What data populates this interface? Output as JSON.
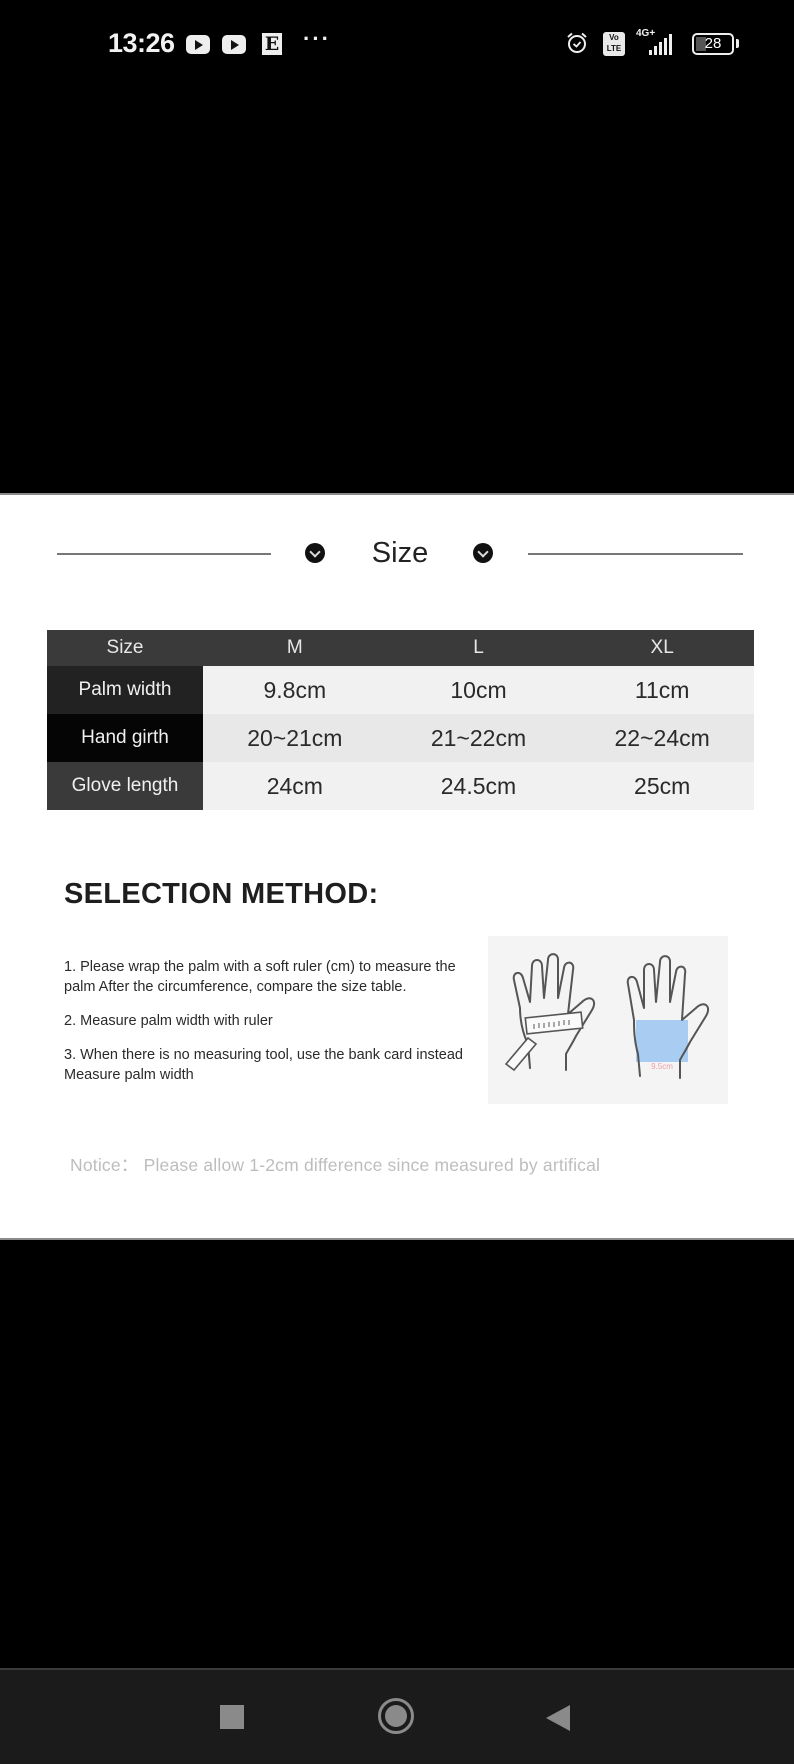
{
  "status_bar": {
    "time": "13:26",
    "notification_icons": [
      "youtube-icon",
      "youtube-icon",
      "e-app-icon"
    ],
    "more": "···",
    "alarm_icon": "alarm-clock-icon",
    "volte_top": "Vo",
    "volte_bottom": "LTE",
    "network": "4G+",
    "battery_level": "28",
    "battery_fraction": 0.28
  },
  "size_section": {
    "heading": "Size",
    "table": {
      "headers": [
        "Size",
        "M",
        "L",
        "XL"
      ],
      "rows": [
        {
          "label": "Palm width",
          "values": [
            "9.8cm",
            "10cm",
            "11cm"
          ]
        },
        {
          "label": "Hand girth",
          "values": [
            "20~21cm",
            "21~22cm",
            "22~24cm"
          ]
        },
        {
          "label": "Glove length",
          "values": [
            "24cm",
            "24.5cm",
            "25cm"
          ]
        }
      ]
    }
  },
  "selection_method": {
    "title": "SELECTION METHOD:",
    "steps": [
      "1. Please wrap the palm with a soft ruler (cm) to measure the palm After the circumference, compare the size table.",
      "2. Measure palm width with ruler",
      "3. When there is no measuring tool, use the bank card instead Measure palm width"
    ],
    "illustration": {
      "left_hand": "hand-with-ruler",
      "right_hand": "hand-with-card",
      "card_label": "9.5cm",
      "card_color": "#a9cdf2",
      "label_color": "#f0a0a8"
    }
  },
  "notice": "Notice：  Please allow 1-2cm difference since measured by artifical",
  "nav_bar": {
    "recent": "recent-apps-icon",
    "home": "home-icon",
    "back": "back-icon"
  }
}
